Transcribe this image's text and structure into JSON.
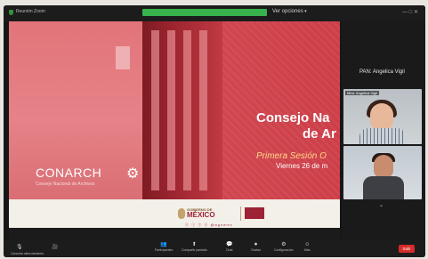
{
  "window": {
    "title": "Reunión Zoom",
    "view_options": "Ver opciones",
    "controls": "— □ ✕"
  },
  "slide": {
    "headline_line1": "Consejo Na",
    "headline_line2": "de Ar",
    "session": "Primera Sesión O",
    "date": "Viernes 26 de m",
    "brand": "CONARCH",
    "brand_sub": "Consejo Nacional de Archivos",
    "gov_top": "GOBIERNO DE",
    "gov": "MÉXICO",
    "social": "ⓕ ⓘ ⓣ ⓨ @agnmex"
  },
  "side": {
    "host_label": "PAN: Angelica Vigil",
    "tile1_name": "Mtra. Angelica Vigil",
    "tile2_name": "",
    "more_chevron": "⌄"
  },
  "toolbar": {
    "mic_label": "Cancelar silenciamiento",
    "items": [
      {
        "icon": "👥",
        "label": "Participantes"
      },
      {
        "icon": "⬆",
        "label": "Compartir pantalla"
      },
      {
        "icon": "💬",
        "label": "Chat"
      },
      {
        "icon": "⏺",
        "label": "Grabar"
      },
      {
        "icon": "⚙",
        "label": "Configuración"
      },
      {
        "icon": "☺",
        "label": "Más"
      }
    ],
    "leave_label": "Salir"
  },
  "colors": {
    "accent_green": "#37b24d",
    "leave_red": "#d72b2b",
    "slide_red": "#c94048",
    "gov_red": "#9d2235"
  }
}
